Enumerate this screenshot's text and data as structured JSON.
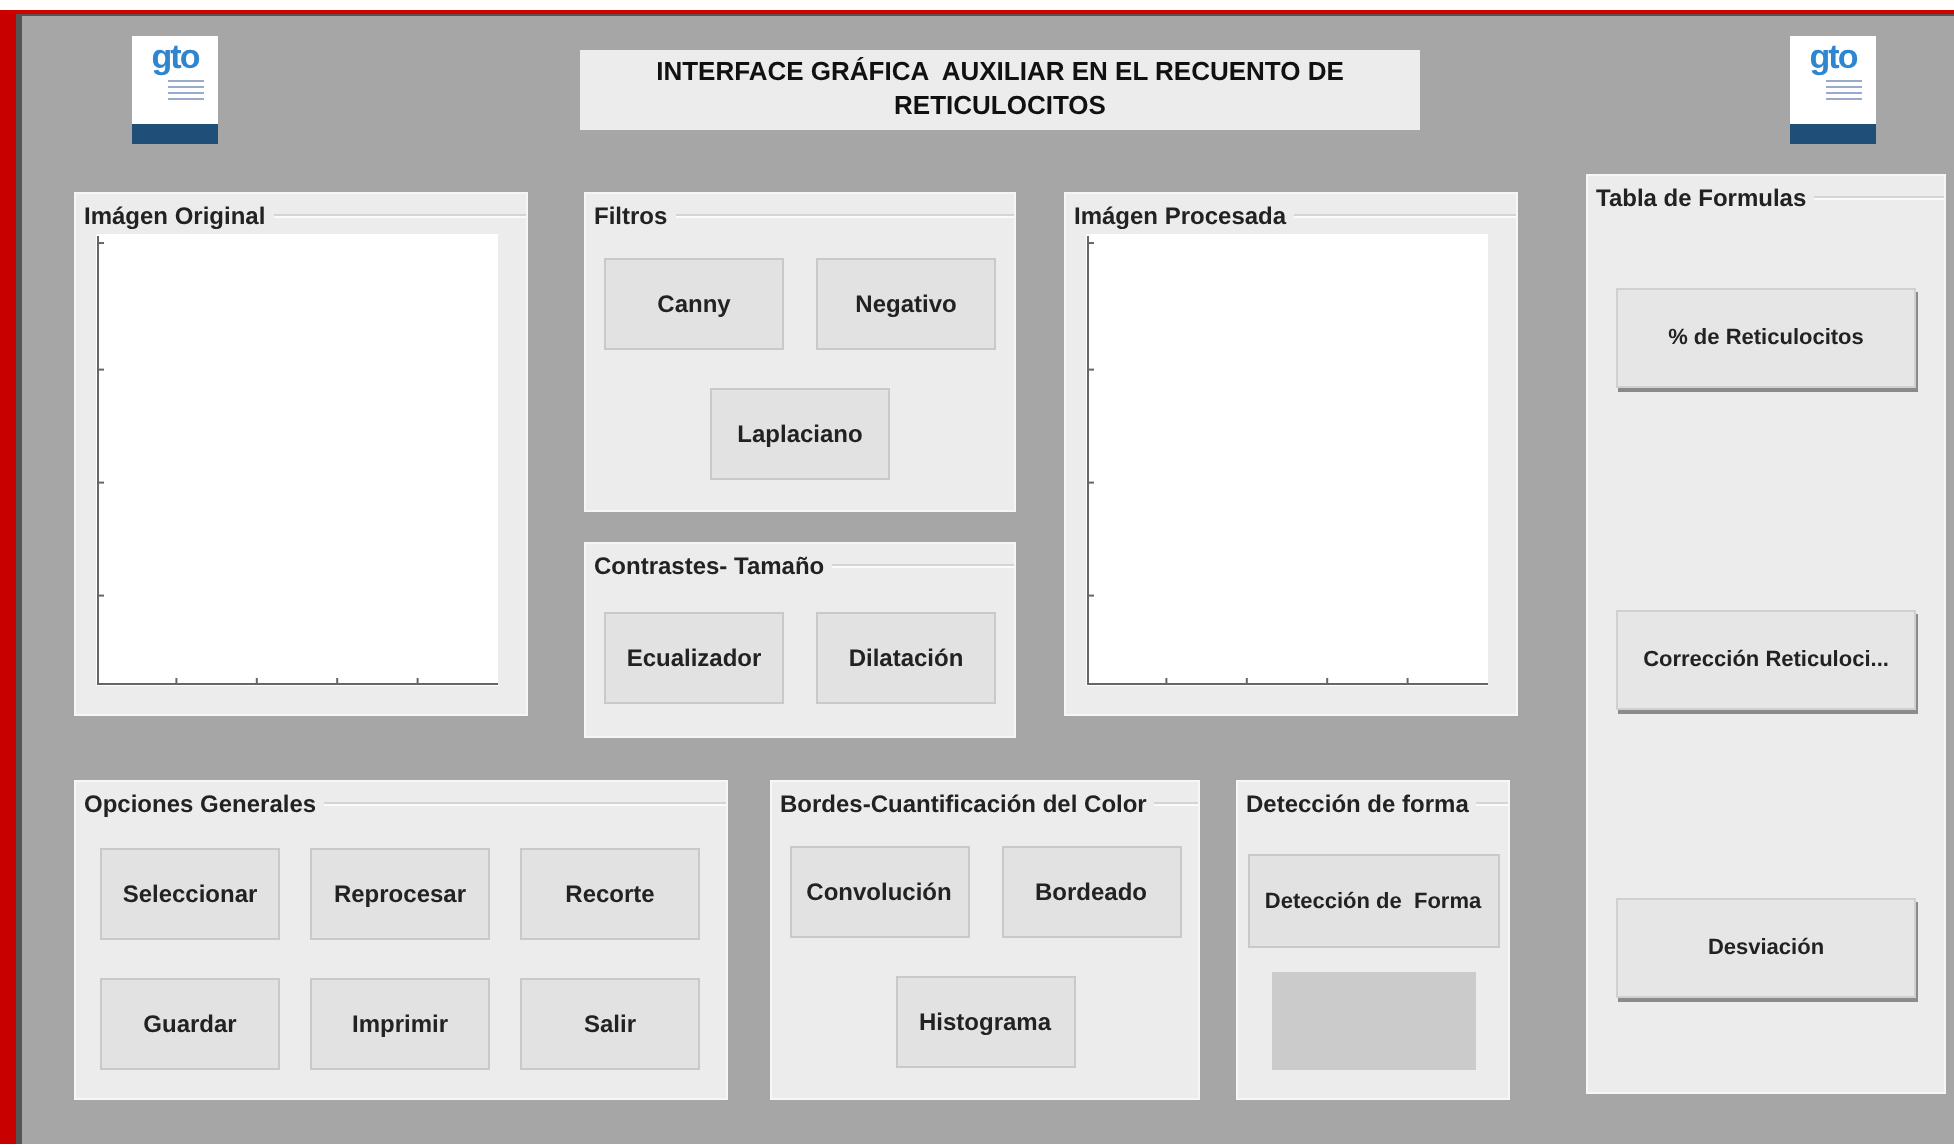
{
  "header": {
    "title": "INTERFACE GRÁFICA  AUXILIAR EN EL RECUENTO DE RETICULOCITOS",
    "logos": [
      {
        "text": "gto"
      },
      {
        "text": "gto"
      }
    ]
  },
  "original_image": {
    "title": "Imágen Original"
  },
  "filters": {
    "title": "Filtros",
    "buttons": [
      "Canny",
      "Negativo",
      "Laplaciano"
    ]
  },
  "contrast_size": {
    "title": "Contrastes- Tamaño",
    "buttons": [
      "Ecualizador",
      "Dilatación"
    ]
  },
  "processed_image": {
    "title": "Imágen Procesada"
  },
  "formula_table": {
    "title": "Tabla de Formulas",
    "buttons": [
      "% de Reticulocitos",
      "Corrección Reticuloci...",
      "Desviación"
    ]
  },
  "general_options": {
    "title": "Opciones Generales",
    "buttons": [
      "Seleccionar",
      "Reprocesar",
      "Recorte",
      "Guardar",
      "Imprimir",
      "Salir"
    ]
  },
  "edges_color": {
    "title": "Bordes-Cuantificación del Color",
    "buttons": [
      "Convolución",
      "Bordeado",
      "Histograma"
    ]
  },
  "shape_detection": {
    "title": "Detección de forma",
    "buttons": [
      "Detección de  Forma"
    ]
  }
}
